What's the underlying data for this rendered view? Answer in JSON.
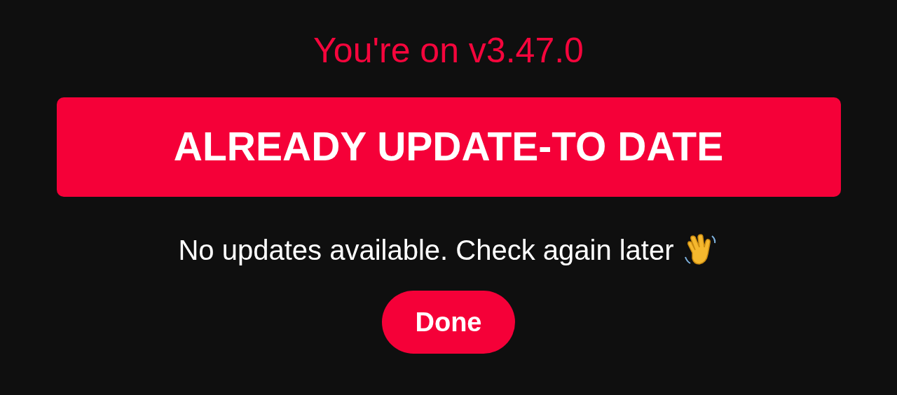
{
  "version_title": "You're on v3.47.0",
  "status_banner": "ALREADY UPDATE-TO DATE",
  "message": "No updates available. Check again later",
  "done_button": "Done"
}
